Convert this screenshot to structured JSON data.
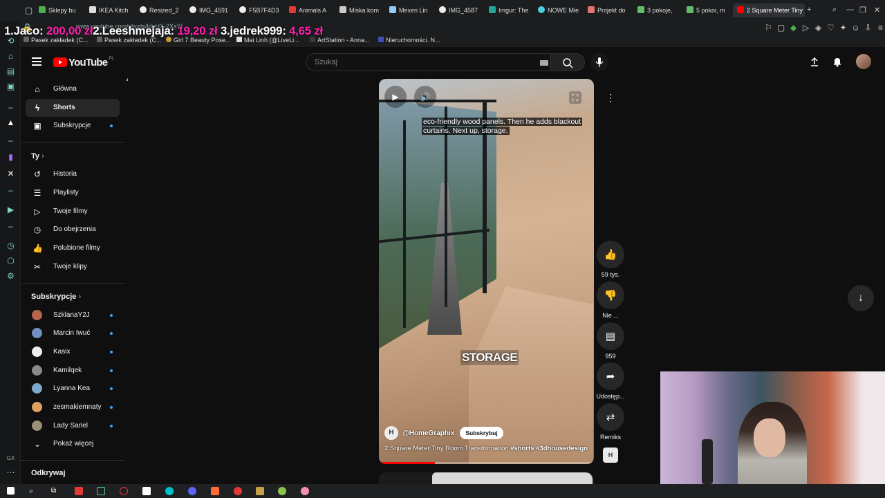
{
  "browser": {
    "tabs": [
      {
        "label": "Sklepy bu"
      },
      {
        "label": "IKEA Kitch"
      },
      {
        "label": "Resized_2"
      },
      {
        "label": "IMG_4591"
      },
      {
        "label": "F5B7F4D3"
      },
      {
        "label": "Animals A"
      },
      {
        "label": "Miska kom"
      },
      {
        "label": "Mexen Lin"
      },
      {
        "label": "IMG_4587"
      },
      {
        "label": "Imgur: The"
      },
      {
        "label": "NOWE Mie"
      },
      {
        "label": "Projekt do"
      },
      {
        "label": "3 pokoje,"
      },
      {
        "label": "5 pokoi, m"
      },
      {
        "label": "2 Square Meter Tiny"
      }
    ],
    "new_tab": "+",
    "url": "www.youtube.com/shorts/ldpHX-2XsYI",
    "bookmarks": [
      {
        "label": "Pasek zakładek (C..."
      },
      {
        "label": "Pasek zakładek (C..."
      },
      {
        "label": "Girl 7 Beauty Pose..."
      },
      {
        "label": "Mai Linh (@LiveLi..."
      },
      {
        "label": "ArtStation - Anna..."
      },
      {
        "label": "Nieruchomości. N..."
      }
    ]
  },
  "donations": [
    {
      "rank_name": "1.Jaco:",
      "amount": "200,00 zł"
    },
    {
      "rank_name": "2.Leeshmejaja:",
      "amount": "19,20 zł"
    },
    {
      "rank_name": "3.jedrek999:",
      "amount": "4,65 zł"
    }
  ],
  "youtube": {
    "logo_text": "YouTube",
    "logo_country": "PL",
    "search_placeholder": "Szukaj",
    "nav": {
      "main": [
        {
          "label": "Główna",
          "icon": "home-icon"
        },
        {
          "label": "Shorts",
          "icon": "shorts-icon"
        },
        {
          "label": "Subskrypcje",
          "icon": "subscriptions-icon"
        }
      ],
      "you_title": "Ty",
      "you": [
        {
          "label": "Historia",
          "icon": "history-icon"
        },
        {
          "label": "Playlisty",
          "icon": "playlists-icon"
        },
        {
          "label": "Twoje filmy",
          "icon": "your-videos-icon"
        },
        {
          "label": "Do obejrzenia",
          "icon": "watch-later-icon"
        },
        {
          "label": "Polubione filmy",
          "icon": "liked-icon"
        },
        {
          "label": "Twoje klipy",
          "icon": "clips-icon"
        }
      ],
      "subs_title": "Subskrypcje",
      "subs": [
        {
          "label": "SzklanaY2J",
          "color": "#b5654a"
        },
        {
          "label": "Marcin Iwuć",
          "color": "#6f8fbf"
        },
        {
          "label": "Kasix",
          "color": "#eeeeee"
        },
        {
          "label": "Kamilqek",
          "color": "#8a8a8a"
        },
        {
          "label": "Lyanna Kea",
          "color": "#7fa7c9"
        },
        {
          "label": "zesmakiemnaty",
          "color": "#e0a062"
        },
        {
          "label": "Lady Sariel",
          "color": "#9a8f74"
        }
      ],
      "show_more": "Pokaż więcej",
      "explore_title": "Odkrywaj"
    },
    "short": {
      "caption": "eco-friendly wood panels. Then he adds blackout curtains. Next up, storage.",
      "overlay_text": "STORAGE",
      "channel_initial": "H",
      "channel": "@HomeGraphix",
      "subscribe": "Subskrybuj",
      "title": "2 Square Meter Tiny Room Transformation",
      "title_tags": "#shorts #3dhousedesign",
      "progress": 0.26
    },
    "actions": {
      "likes": "59 tys.",
      "dislike": "Nie ...",
      "comments": "959",
      "share": "Udostęp...",
      "remix": "Remiks"
    }
  },
  "colors": {
    "accent": "#ff0000",
    "donation_amount": "#ff1fb0",
    "dot": "#3ea6ff"
  }
}
